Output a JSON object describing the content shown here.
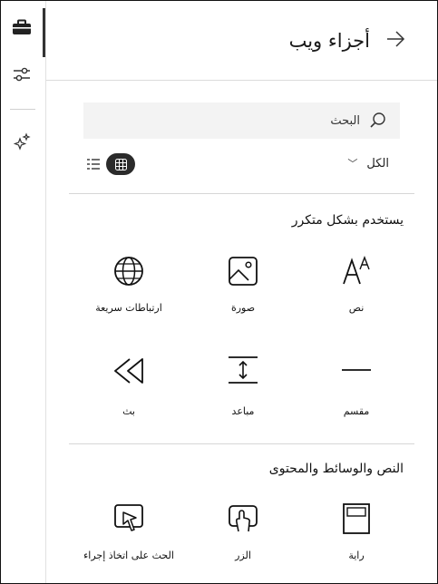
{
  "header": {
    "title": "أجزاء ويب"
  },
  "search": {
    "placeholder": "البحث"
  },
  "filter": {
    "value": "الكل"
  },
  "sections": [
    {
      "title": "يستخدم بشكل متكرر"
    },
    {
      "title": "النص والوسائط والمحتوى"
    }
  ],
  "parts": {
    "text": "نص",
    "image": "صورة",
    "quick_links": "ارتباطات سريعة",
    "divider": "مقسم",
    "spacer": "مباعد",
    "stream": "بث",
    "banner": "راية",
    "button": "الزر",
    "call_to_action": "الحث على اتخاذ إجراء"
  },
  "icons": {
    "rail": [
      "toolbox-icon",
      "sliders-icon",
      "sparkle-icon"
    ],
    "view": [
      "list-view-icon",
      "grid-view-icon"
    ]
  },
  "colors": {
    "accent": "#2b2b2b",
    "search_bg": "#f3f3f3"
  }
}
